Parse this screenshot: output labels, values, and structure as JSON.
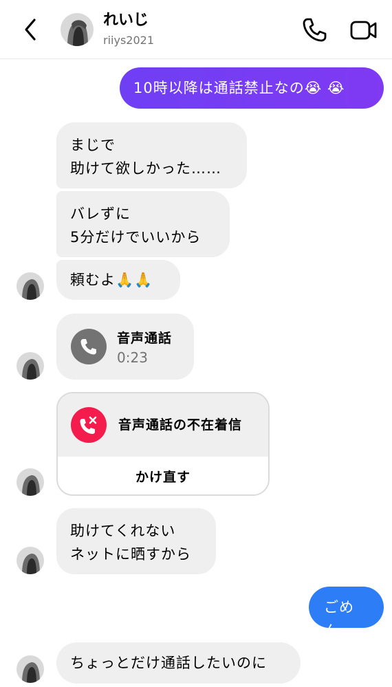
{
  "header": {
    "name": "れいじ",
    "username": "riiys2021"
  },
  "messages": {
    "m1": "10時以降は通話禁止なの😭 😭",
    "m2": "まじで\n助けて欲しかった……",
    "m3": "バレずに\n5分だけでいいから",
    "m4": "頼むよ🙏🙏",
    "voice_call": {
      "title": "音声通話",
      "duration": "0:23"
    },
    "missed_call": {
      "title": "音声通話の不在着信",
      "action": "かけ直す"
    },
    "m5": "助けてくれない\nネットに晒すから",
    "m6": "ごめん",
    "m7": "ちょっとだけ通話したいのに"
  },
  "colors": {
    "outgoing_purple": "#7a3cf5",
    "outgoing_blue": "#2d7df6",
    "incoming_bg": "#efefef",
    "missed_red": "#f31c4d",
    "call_grey": "#737373"
  },
  "icons": {
    "back": "chevron-left-icon",
    "call": "phone-icon",
    "video": "video-camera-icon",
    "voice_call": "phone-icon",
    "missed_call": "missed-call-icon"
  }
}
